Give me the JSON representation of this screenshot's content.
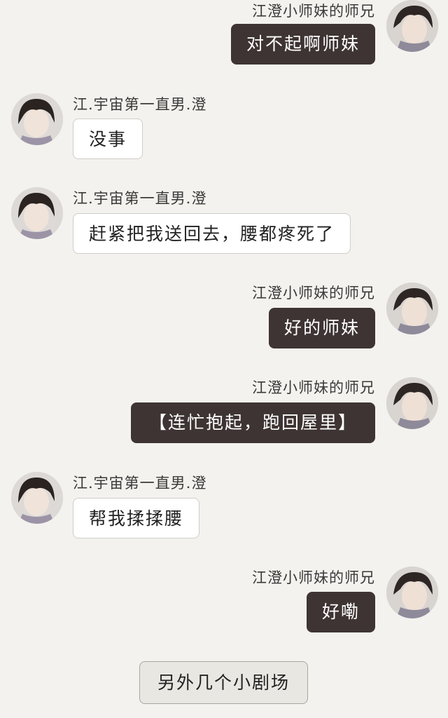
{
  "messages": [
    {
      "side": "right",
      "sender": "江澄小师妹的师兄",
      "text": "对不起啊师妹"
    },
    {
      "side": "left",
      "sender": "江.宇宙第一直男.澄",
      "text": "没事"
    },
    {
      "side": "left",
      "sender": "江.宇宙第一直男.澄",
      "text": "赶紧把我送回去，腰都疼死了"
    },
    {
      "side": "right",
      "sender": "江澄小师妹的师兄",
      "text": "好的师妹"
    },
    {
      "side": "right",
      "sender": "江澄小师妹的师兄",
      "text": "【连忙抱起，跑回屋里】"
    },
    {
      "side": "left",
      "sender": "江.宇宙第一直男.澄",
      "text": "帮我揉揉腰"
    },
    {
      "side": "right",
      "sender": "江澄小师妹的师兄",
      "text": "好嘞"
    }
  ],
  "more_button": {
    "label": "另外几个小剧场"
  },
  "colors": {
    "background": "#f3f2ee",
    "outgoing_bubble": "#3e3433",
    "incoming_bubble": "#ffffff"
  }
}
